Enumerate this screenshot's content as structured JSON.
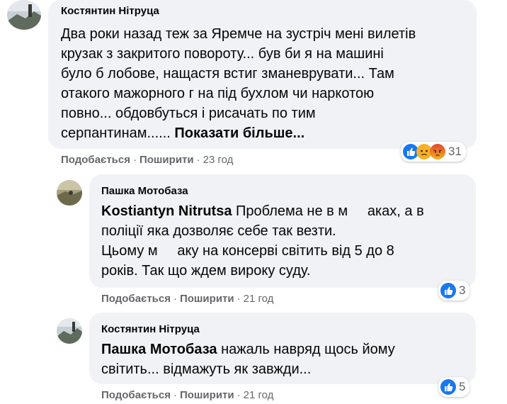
{
  "comments": [
    {
      "author": "Костянтин Нітруца",
      "lines": [
        "Два роки назад теж за Яремче на зустріч мені вилетів",
        "крузак з закритого повороту... був би я на машині",
        "було б лобове, нащастя встиг зманеврувати... Там",
        "отакого мажорного г    на під бухлом чи наркотою",
        "повно... обдовбуться і рисачать по тим"
      ],
      "last_line": "серпантинам......",
      "see_more": "Показати більше...",
      "like": "Подобається",
      "share": "Поширити",
      "time": "23 год",
      "reaction_count": "31",
      "reactions": [
        "like-icon",
        "sad-icon",
        "angry-icon"
      ]
    },
    {
      "author": "Пашка Мотобаза",
      "mention": "Kostiantyn Nitrutsa",
      "first_line": " Проблема не в м     аках, а в",
      "lines": [
        "поліції яка дозволяє себе так везти.",
        "Цьому м     аку на консерві світить від 5 до 8",
        "років. Так що ждем вироку суду."
      ],
      "like": "Подобається",
      "share": "Поширити",
      "time": "21 год",
      "reaction_count": "3",
      "reactions": [
        "like-icon"
      ]
    },
    {
      "author": "Костянтин Нітруца",
      "mention": "Пашка Мотобаза",
      "first_line": " нажаль навряд щось йому",
      "lines": [
        "світить... відмажуть як завжди..."
      ],
      "like": "Подобається",
      "share": "Поширити",
      "time": "21 год",
      "reaction_count": "5",
      "reactions": [
        "like-icon"
      ]
    }
  ],
  "colors": {
    "bubble": "#f0f2f5",
    "meta": "#65676b",
    "like_blue": "#1877f2",
    "angry": "#e9710f",
    "sad": "#f7b125"
  }
}
